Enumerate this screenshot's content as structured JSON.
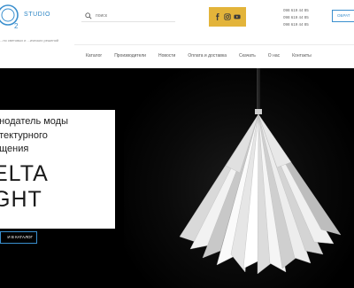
{
  "brand": {
    "studio": "STUDIO",
    "tagline": "...но световых и ...ических решений"
  },
  "search": {
    "placeholder": "поиск"
  },
  "socials": [
    {
      "icon": "facebook-icon",
      "glyph": "f"
    },
    {
      "icon": "instagram-icon",
      "glyph": "◻"
    },
    {
      "icon": "youtube-icon",
      "glyph": "▶"
    }
  ],
  "phones": [
    "098 619 44 85",
    "098 619 44 85",
    "098 619 44 85"
  ],
  "header": {
    "cta_label": "ОБРАТ"
  },
  "nav": {
    "items": [
      "Каталог",
      "Производители",
      "Новости",
      "Оплата и доставка",
      "Скачать",
      "О нас",
      "Контакты"
    ]
  },
  "hero": {
    "title_line1": "онодатель моды",
    "title_line2": "итектурного",
    "title_line3": "ещения",
    "brand_line1": "ELTA",
    "brand_line2": "GHT",
    "catalog_button": "И В КАТАЛОГ"
  },
  "colors": {
    "accent": "#3a8fce",
    "social_bg": "#e3b43a",
    "hero_bg": "#000000"
  }
}
